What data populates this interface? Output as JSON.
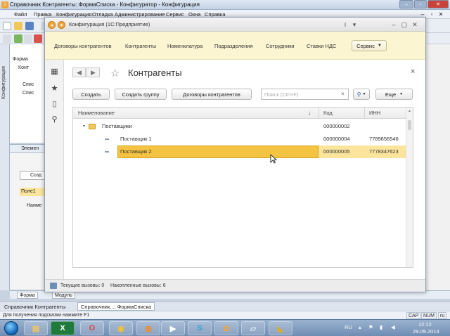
{
  "outer_window": {
    "title": "Справочник Контрагенты: ФормаСписка - Конфигуратор - Конфигурация",
    "menu": [
      "Файл",
      "Правка",
      "Конфигурация",
      "Отладка",
      "Администрирование",
      "Сервис",
      "Окна",
      "Справка"
    ],
    "side_label": "Конфигурация",
    "tree": [
      "Форма",
      "Конт",
      "Спис",
      "Спис"
    ],
    "elements_label": "Элемен",
    "left_form": {
      "create": "Созд",
      "field": "Поле1",
      "name_col": "Наиме"
    },
    "bottom_tabs": [
      "Форма",
      "Модуль"
    ],
    "inner_tabs": [
      "Справочник Контрагенты",
      "Справочник...: ФормаСписка"
    ],
    "status_hint": "Для получения подсказки нажмите F1",
    "indicators": [
      "CAP",
      "NUM",
      "ru"
    ]
  },
  "enterprise_window": {
    "title": "Конфигурация (1С:Предприятие)",
    "sections": [
      "Договоры контрагентов",
      "Контрагенты",
      "Номенклатура",
      "Подразделения",
      "Сотрудники",
      "Ставки НДС"
    ],
    "service_label": "Сервис",
    "form_title": "Контрагенты",
    "buttons": {
      "create": "Создать",
      "create_group": "Создать группу",
      "contracts": "Договоры контрагентов",
      "more": "Еще"
    },
    "search_placeholder": "Поиск (Ctrl+F)",
    "columns": {
      "name": "Наименование",
      "code": "Код",
      "inn": "ИНН"
    },
    "rows": [
      {
        "name": "Поставщики",
        "code": "000000002",
        "inn": "",
        "type": "group"
      },
      {
        "name": "Поставщик 1",
        "code": "000000004",
        "inn": "7789656546",
        "type": "item"
      },
      {
        "name": "Поставщик 2",
        "code": "000000005",
        "inn": "7778347623",
        "type": "item",
        "selected": true
      }
    ],
    "status": {
      "current": "Текущие вызовы: 0",
      "accumulated": "Накопленные вызовы: 6"
    }
  },
  "taskbar": {
    "lang": "RU",
    "time": "12:12",
    "date": "29.09.2014"
  },
  "colors": {
    "section_bg": "#fbf5d2",
    "selection": "#f5c342",
    "accent_orange": "#f0a63b"
  }
}
